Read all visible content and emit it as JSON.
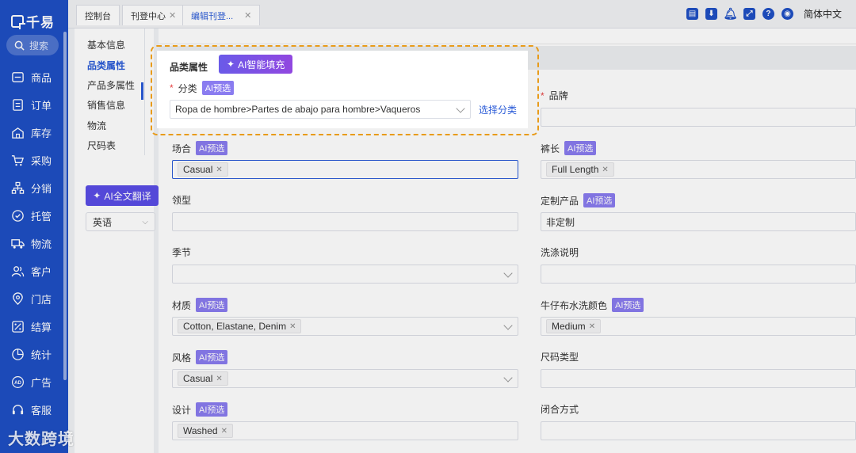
{
  "sidebar": {
    "logo_text": "千易",
    "search_label": "搜索",
    "items": [
      {
        "label": "商品",
        "icon": "product-icon"
      },
      {
        "label": "订单",
        "icon": "order-icon"
      },
      {
        "label": "库存",
        "icon": "warehouse-icon"
      },
      {
        "label": "采购",
        "icon": "cart-icon"
      },
      {
        "label": "分销",
        "icon": "distribution-icon"
      },
      {
        "label": "托管",
        "icon": "hosting-icon"
      },
      {
        "label": "物流",
        "icon": "truck-icon"
      },
      {
        "label": "客户",
        "icon": "customer-icon"
      },
      {
        "label": "门店",
        "icon": "store-icon"
      },
      {
        "label": "结算",
        "icon": "settlement-icon"
      },
      {
        "label": "统计",
        "icon": "statistics-icon"
      },
      {
        "label": "广告",
        "icon": "ad-icon"
      },
      {
        "label": "客服",
        "icon": "headset-icon"
      }
    ]
  },
  "tabs": [
    {
      "label": "控制台",
      "closable": false
    },
    {
      "label": "刊登中心",
      "closable": true
    },
    {
      "label": "编辑刊登...",
      "closable": true,
      "active": true
    }
  ],
  "topbar": {
    "language": "简体中文"
  },
  "section_nav": {
    "items": [
      "基本信息",
      "品类属性",
      "产品多属性",
      "销售信息",
      "物流",
      "尺码表"
    ],
    "active_index": 1,
    "ai_translate_label": "AI全文翻译",
    "language_value": "英语"
  },
  "popup": {
    "title": "品类属性",
    "ai_fill_label": "AI智能填充",
    "category_label": "分类",
    "ai_badge": "AI预选",
    "category_value": "Ropa de hombre>Partes de abajo para hombre>Vaqueros",
    "choose_label": "选择分类"
  },
  "form": {
    "brand_label": "品牌",
    "ai_badge": "AI预选",
    "occasion": {
      "label": "场合",
      "chips": [
        "Casual"
      ]
    },
    "length": {
      "label": "裤长",
      "chips": [
        "Full Length"
      ]
    },
    "collar": {
      "label": "领型"
    },
    "custom": {
      "label": "定制产品",
      "value": "非定制"
    },
    "season": {
      "label": "季节"
    },
    "wash_note": {
      "label": "洗涤说明"
    },
    "material": {
      "label": "材质",
      "chips": [
        "Cotton, Elastane, Denim"
      ]
    },
    "denim_wash": {
      "label": "牛仔布水洗颜色",
      "chips": [
        "Medium"
      ]
    },
    "style": {
      "label": "风格",
      "chips": [
        "Casual"
      ]
    },
    "size_type": {
      "label": "尺码类型"
    },
    "design": {
      "label": "设计",
      "chips": [
        "Washed"
      ]
    },
    "closure": {
      "label": "闭合方式"
    }
  },
  "watermark": "大数跨境",
  "colors": {
    "sidebar": "#1e4fc4",
    "accent": "#2a5bd7",
    "ai_badge": "#8a7cf0",
    "highlight": "#e89b1a"
  }
}
